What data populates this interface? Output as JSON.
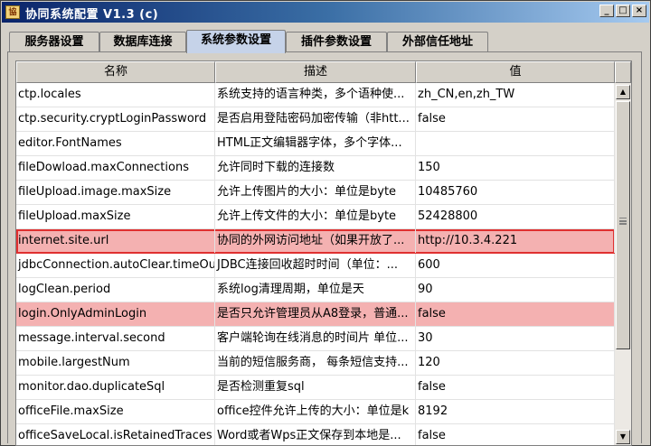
{
  "window": {
    "title": "协同系统配置 V1.3 (c)",
    "buttons": {
      "minimize": "_",
      "maximize": "□",
      "close": "×"
    }
  },
  "tabs": [
    {
      "label": "服务器设置",
      "active": false
    },
    {
      "label": "数据库连接",
      "active": false
    },
    {
      "label": "系统参数设置",
      "active": true
    },
    {
      "label": "插件参数设置",
      "active": false
    },
    {
      "label": "外部信任地址",
      "active": false
    }
  ],
  "table": {
    "headers": [
      "名称",
      "描述",
      "值"
    ],
    "rows": [
      {
        "name": "ctp.locales",
        "desc": "系统支持的语言种类，多个语种使...",
        "value": "zh_CN,en,zh_TW",
        "state": "normal"
      },
      {
        "name": "ctp.security.cryptLoginPassword",
        "desc": "是否启用登陆密码加密传输（非htt...",
        "value": "false",
        "state": "normal"
      },
      {
        "name": "editor.FontNames",
        "desc": "HTML正文编辑器字体，多个字体...",
        "value": "",
        "state": "normal"
      },
      {
        "name": "fileDowload.maxConnections",
        "desc": "允许同时下载的连接数",
        "value": "150",
        "state": "normal"
      },
      {
        "name": "fileUpload.image.maxSize",
        "desc": "允许上传图片的大小：单位是byte",
        "value": "10485760",
        "state": "normal"
      },
      {
        "name": "fileUpload.maxSize",
        "desc": "允许上传文件的大小：单位是byte",
        "value": "52428800",
        "state": "normal"
      },
      {
        "name": "internet.site.url",
        "desc": "协同的外网访问地址（如果开放了...",
        "value": "http://10.3.4.221",
        "state": "selected"
      },
      {
        "name": "jdbcConnection.autoClear.timeOut",
        "desc": "JDBC连接回收超时时间（单位：...",
        "value": "600",
        "state": "normal"
      },
      {
        "name": "logClean.period",
        "desc": "系统log清理周期，单位是天",
        "value": "90",
        "state": "normal"
      },
      {
        "name": "login.OnlyAdminLogin",
        "desc": "是否只允许管理员从A8登录，普通...",
        "value": "false",
        "state": "highlight"
      },
      {
        "name": "message.interval.second",
        "desc": "客户端轮询在线消息的时间片 单位...",
        "value": "30",
        "state": "normal"
      },
      {
        "name": "mobile.largestNum",
        "desc": "当前的短信服务商， 每条短信支持...",
        "value": "120",
        "state": "normal"
      },
      {
        "name": "monitor.dao.duplicateSql",
        "desc": "是否检测重复sql",
        "value": "false",
        "state": "normal"
      },
      {
        "name": "officeFile.maxSize",
        "desc": "office控件允许上传的大小：单位是k",
        "value": "8192",
        "state": "normal"
      },
      {
        "name": "officeSaveLocal.isRetainedTraces",
        "desc": "Word或者Wps正文保存到本地是...",
        "value": "false",
        "state": "normal"
      }
    ]
  },
  "scrollbar": {
    "up_arrow": "▲",
    "down_arrow": "▼",
    "position": 0.1
  },
  "colors": {
    "highlight": "#f4b1b1",
    "selected_border": "#e03030",
    "active_tab": "#c6d3e9"
  }
}
